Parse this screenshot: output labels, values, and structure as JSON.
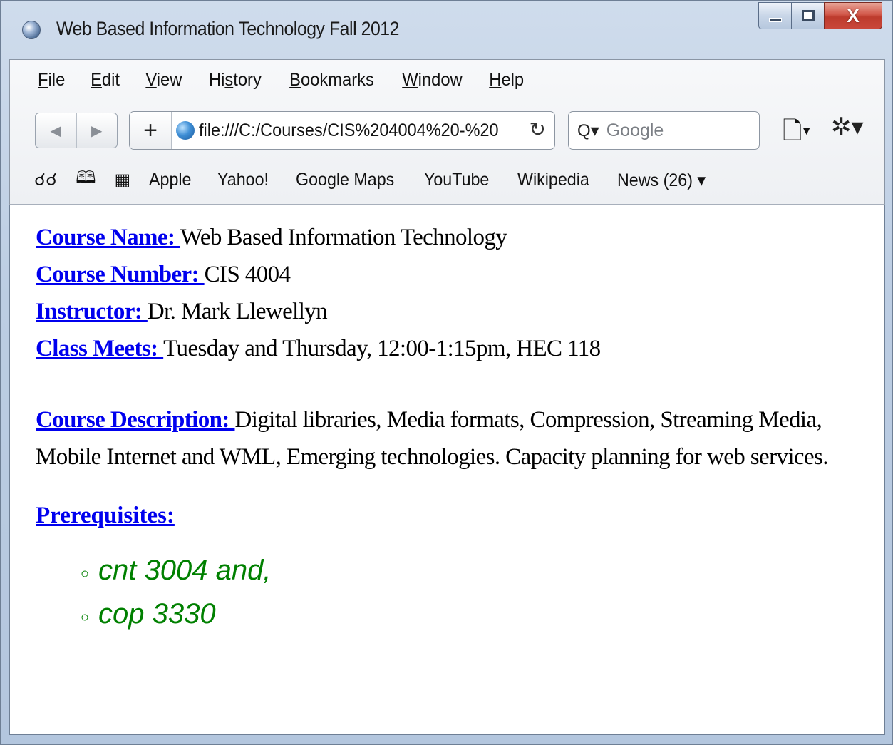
{
  "window": {
    "title": "Web Based Information Technology Fall 2012"
  },
  "menu": [
    "File",
    "Edit",
    "View",
    "History",
    "Bookmarks",
    "Window",
    "Help"
  ],
  "toolbar": {
    "back_glyph": "◀",
    "forward_glyph": "▶",
    "add_glyph": "+",
    "address": "file:///C:/Courses/CIS%204004%20-%20",
    "reload_glyph": "↻",
    "search_placeholder": "Google",
    "search_glyph": "Q▾",
    "page_menu_glyph": "🗋▾",
    "settings_glyph": "✲▾"
  },
  "bookmarks_bar": {
    "reading_list_icon": "glasses-icon",
    "bookmarks_icon": "book-icon",
    "top_sites_icon": "grid-icon",
    "items": [
      "Apple",
      "Yahoo!",
      "Google Maps",
      "YouTube",
      "Wikipedia",
      "News (26) ▾"
    ]
  },
  "page": {
    "course_name": {
      "label": "Course Name: ",
      "value": "Web Based Information Technology"
    },
    "course_number": {
      "label": "Course Number: ",
      "value": "CIS 4004"
    },
    "instructor": {
      "label": "Instructor: ",
      "value": "Dr. Mark Llewellyn"
    },
    "class_meets": {
      "label": "Class Meets: ",
      "value": "Tuesday and Thursday, 12:00-1:15pm, HEC 118"
    },
    "course_description": {
      "label": "Course Description: ",
      "value": "Digital libraries, Media formats, Compression, Streaming Media, Mobile Internet and WML, Emerging technologies. Capacity planning for web services."
    },
    "prerequisites": {
      "label": "Prerequisites:",
      "items": [
        "cnt 3004 and,",
        "cop 3330"
      ]
    }
  },
  "colors": {
    "link": "#0000ee",
    "prereq_text": "#008000",
    "close_button": "#c9473a"
  }
}
